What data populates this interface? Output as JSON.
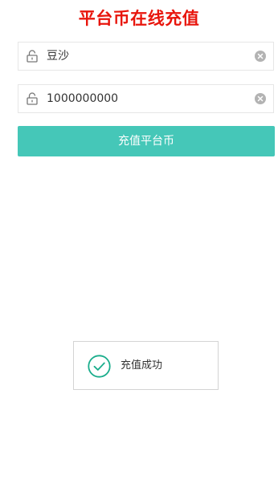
{
  "page": {
    "title": "平台币在线充值"
  },
  "form": {
    "username": {
      "value": "豆沙",
      "icon": "lock-icon"
    },
    "amount": {
      "value": "1000000000",
      "icon": "lock-icon"
    },
    "clear_icon": "clear-icon",
    "submit_label": "充值平台币"
  },
  "toast": {
    "icon": "check-circle-icon",
    "message": "充值成功"
  },
  "colors": {
    "title": "#e8150c",
    "accent": "#45c7b8",
    "success": "#1aad8c",
    "clear_icon": "#b3b3b3",
    "field_border": "#e6e6e6"
  }
}
